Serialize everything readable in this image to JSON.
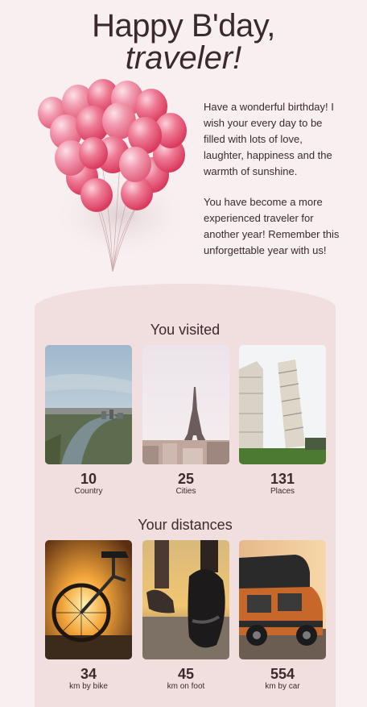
{
  "header": {
    "title_line1": "Happy B'day,",
    "title_line2": "traveler!"
  },
  "greeting": {
    "paragraph1": "Have a wonderful birthday! I wish your every day to be filled with lots of love, laughter, happiness and the warmth of sunshine.",
    "paragraph2": "You have become a more experienced traveler for another year! Remember this unforgettable year with us!"
  },
  "visited": {
    "title": "You visited",
    "items": [
      {
        "value": "10",
        "label": "Country"
      },
      {
        "value": "25",
        "label": "Cities"
      },
      {
        "value": "131",
        "label": "Places"
      }
    ]
  },
  "distances": {
    "title": "Your distances",
    "items": [
      {
        "value": "34",
        "label": "km by bike"
      },
      {
        "value": "45",
        "label": "km on foot"
      },
      {
        "value": "554",
        "label": "km by car"
      }
    ]
  },
  "colors": {
    "background": "#f8eff1",
    "card": "#f1dfe0",
    "text": "#3b2a2c",
    "balloon": "#e8506e"
  },
  "images": {
    "balloons": "pink-balloons-image",
    "visited": [
      "aerial-city-river-image",
      "eiffel-tower-image",
      "leaning-tower-pisa-image"
    ],
    "distances": [
      "bicycle-wheel-sunset-image",
      "running-shoes-image",
      "orange-camper-van-image"
    ]
  }
}
